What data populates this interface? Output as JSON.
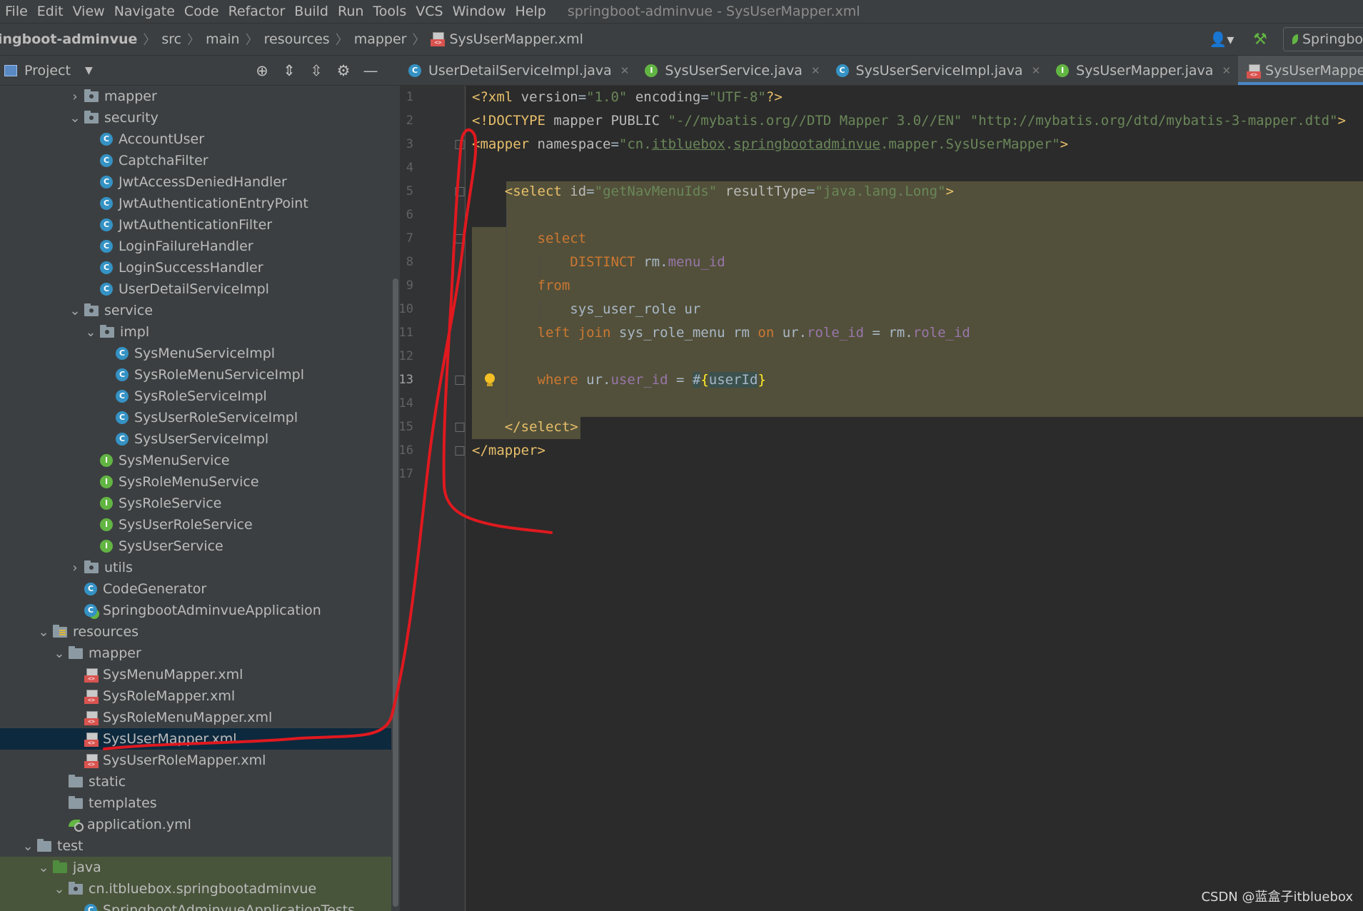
{
  "menubar": {
    "items": [
      "File",
      "Edit",
      "View",
      "Navigate",
      "Code",
      "Refactor",
      "Build",
      "Run",
      "Tools",
      "VCS",
      "Window",
      "Help"
    ],
    "window_title": "springboot-adminvue - SysUserMapper.xml"
  },
  "navbar": {
    "crumbs": [
      "ingboot-adminvue",
      "src",
      "main",
      "resources",
      "mapper",
      "SysUserMapper.xml"
    ],
    "run_config_label": "Springbo"
  },
  "project_panel": {
    "title": "Project",
    "tree": [
      {
        "label": "mapper",
        "type": "folder-pkg",
        "depth": 4,
        "arrow": "collapsed"
      },
      {
        "label": "security",
        "type": "folder-pkg",
        "depth": 4,
        "arrow": "expanded"
      },
      {
        "label": "AccountUser",
        "type": "class",
        "depth": 5
      },
      {
        "label": "CaptchaFilter",
        "type": "class",
        "depth": 5
      },
      {
        "label": "JwtAccessDeniedHandler",
        "type": "class",
        "depth": 5
      },
      {
        "label": "JwtAuthenticationEntryPoint",
        "type": "class",
        "depth": 5
      },
      {
        "label": "JwtAuthenticationFilter",
        "type": "class",
        "depth": 5
      },
      {
        "label": "LoginFailureHandler",
        "type": "class",
        "depth": 5
      },
      {
        "label": "LoginSuccessHandler",
        "type": "class",
        "depth": 5
      },
      {
        "label": "UserDetailServiceImpl",
        "type": "class",
        "depth": 5
      },
      {
        "label": "service",
        "type": "folder-pkg",
        "depth": 4,
        "arrow": "expanded"
      },
      {
        "label": "impl",
        "type": "folder-pkg",
        "depth": 5,
        "arrow": "expanded"
      },
      {
        "label": "SysMenuServiceImpl",
        "type": "class",
        "depth": 6
      },
      {
        "label": "SysRoleMenuServiceImpl",
        "type": "class",
        "depth": 6
      },
      {
        "label": "SysRoleServiceImpl",
        "type": "class",
        "depth": 6
      },
      {
        "label": "SysUserRoleServiceImpl",
        "type": "class",
        "depth": 6
      },
      {
        "label": "SysUserServiceImpl",
        "type": "class",
        "depth": 6
      },
      {
        "label": "SysMenuService",
        "type": "interface",
        "depth": 5
      },
      {
        "label": "SysRoleMenuService",
        "type": "interface",
        "depth": 5
      },
      {
        "label": "SysRoleService",
        "type": "interface",
        "depth": 5
      },
      {
        "label": "SysUserRoleService",
        "type": "interface",
        "depth": 5
      },
      {
        "label": "SysUserService",
        "type": "interface",
        "depth": 5
      },
      {
        "label": "utils",
        "type": "folder-pkg",
        "depth": 4,
        "arrow": "collapsed"
      },
      {
        "label": "CodeGenerator",
        "type": "class",
        "depth": 4
      },
      {
        "label": "SpringbootAdminvueApplication",
        "type": "class-run",
        "depth": 4
      },
      {
        "label": "resources",
        "type": "folder-res",
        "depth": 2,
        "arrow": "expanded"
      },
      {
        "label": "mapper",
        "type": "folder",
        "depth": 3,
        "arrow": "expanded"
      },
      {
        "label": "SysMenuMapper.xml",
        "type": "xml",
        "depth": 4
      },
      {
        "label": "SysRoleMapper.xml",
        "type": "xml",
        "depth": 4
      },
      {
        "label": "SysRoleMenuMapper.xml",
        "type": "xml",
        "depth": 4
      },
      {
        "label": "SysUserMapper.xml",
        "type": "xml",
        "depth": 4,
        "selected": true
      },
      {
        "label": "SysUserRoleMapper.xml",
        "type": "xml",
        "depth": 4
      },
      {
        "label": "static",
        "type": "folder",
        "depth": 3
      },
      {
        "label": "templates",
        "type": "folder",
        "depth": 3
      },
      {
        "label": "application.yml",
        "type": "yml",
        "depth": 3
      },
      {
        "label": "test",
        "type": "folder",
        "depth": 1,
        "arrow": "expanded"
      },
      {
        "label": "java",
        "type": "folder-src",
        "depth": 2,
        "arrow": "expanded",
        "green": true
      },
      {
        "label": "cn.itbluebox.springbootadminvue",
        "type": "folder-pkg",
        "depth": 3,
        "arrow": "expanded",
        "green": true
      },
      {
        "label": "SpringbootAdminvueApplicationTests",
        "type": "class-run",
        "depth": 4,
        "green": true
      }
    ]
  },
  "tabs": [
    {
      "label": "UserDetailServiceImpl.java",
      "icon": "class"
    },
    {
      "label": "SysUserService.java",
      "icon": "interface"
    },
    {
      "label": "SysUserServiceImpl.java",
      "icon": "class"
    },
    {
      "label": "SysUserMapper.java",
      "icon": "interface"
    },
    {
      "label": "SysUserMapper.xml",
      "icon": "xml",
      "active": true
    }
  ],
  "editor": {
    "line_count": 17,
    "current_line": 13,
    "lines": [
      [
        [
          "t-tag",
          "<?xml "
        ],
        [
          "t-at",
          "version"
        ],
        [
          "t-txt",
          "="
        ],
        [
          "t-val",
          "\"1.0\""
        ],
        [
          "t-txt",
          " "
        ],
        [
          "t-at",
          "encoding"
        ],
        [
          "t-txt",
          "="
        ],
        [
          "t-val",
          "\"UTF-8\""
        ],
        [
          "t-tag",
          "?>"
        ]
      ],
      [
        [
          "t-tag",
          "<!DOCTYPE "
        ],
        [
          "t-at",
          "mapper PUBLIC "
        ],
        [
          "t-val",
          "\"-//mybatis.org//DTD Mapper 3.0//EN\" \"http://mybatis.org/dtd/mybatis-3-mapper.dtd\""
        ],
        [
          "t-tag",
          ">"
        ]
      ],
      [
        [
          "t-tag",
          "<mapper "
        ],
        [
          "t-at",
          "namespace"
        ],
        [
          "t-txt",
          "="
        ],
        [
          "t-val",
          "\"cn."
        ],
        [
          "t-val u",
          "itbluebox"
        ],
        [
          "t-val",
          "."
        ],
        [
          "t-val u",
          "springbootadminvue"
        ],
        [
          "t-val",
          ".mapper.SysUserMapper\""
        ],
        [
          "t-tag",
          ">"
        ]
      ],
      [],
      [
        [
          "t-txt",
          "    "
        ],
        [
          "t-tag",
          "<select "
        ],
        [
          "t-at",
          "id"
        ],
        [
          "t-txt",
          "="
        ],
        [
          "t-val",
          "\"getNavMenuIds\""
        ],
        [
          "t-txt",
          " "
        ],
        [
          "t-at",
          "resultType"
        ],
        [
          "t-txt",
          "="
        ],
        [
          "t-val",
          "\"java.lang.Long\""
        ],
        [
          "t-tag",
          ">"
        ]
      ],
      [],
      [
        [
          "t-txt",
          "        "
        ],
        [
          "t-kw",
          "select"
        ]
      ],
      [
        [
          "t-txt",
          "            "
        ],
        [
          "t-kw",
          "DISTINCT "
        ],
        [
          "t-txt",
          "rm."
        ],
        [
          "t-fld",
          "menu_id"
        ]
      ],
      [
        [
          "t-txt",
          "        "
        ],
        [
          "t-kw",
          "from"
        ]
      ],
      [
        [
          "t-txt",
          "            sys_user_role ur"
        ]
      ],
      [
        [
          "t-txt",
          "        "
        ],
        [
          "t-kw",
          "left join "
        ],
        [
          "t-txt",
          "sys_role_menu rm "
        ],
        [
          "t-kw",
          "on "
        ],
        [
          "t-txt",
          "ur."
        ],
        [
          "t-fld",
          "role_id"
        ],
        [
          "t-txt",
          " = rm."
        ],
        [
          "t-fld",
          "role_id"
        ]
      ],
      [],
      [
        [
          "t-txt",
          "        "
        ],
        [
          "t-kw",
          "where "
        ],
        [
          "t-txt",
          "ur."
        ],
        [
          "t-fld",
          "user_id"
        ],
        [
          "t-txt",
          " = "
        ],
        [
          "t-hash",
          "#"
        ],
        [
          "t-brace",
          "{"
        ],
        [
          "t-hash",
          "userId"
        ],
        [
          "t-brace",
          "}"
        ]
      ],
      [],
      [
        [
          "t-txt",
          "    "
        ],
        [
          "t-tag",
          "</select>"
        ]
      ],
      [
        [
          "t-tag",
          "</mapper>"
        ]
      ],
      []
    ]
  },
  "watermark": "CSDN @蓝盒子itbluebox",
  "colors": {
    "annotation_stroke": "#e0191f",
    "selection": "#0d293e",
    "highlight": "#52503a",
    "accent_tab": "#4a88c7"
  }
}
